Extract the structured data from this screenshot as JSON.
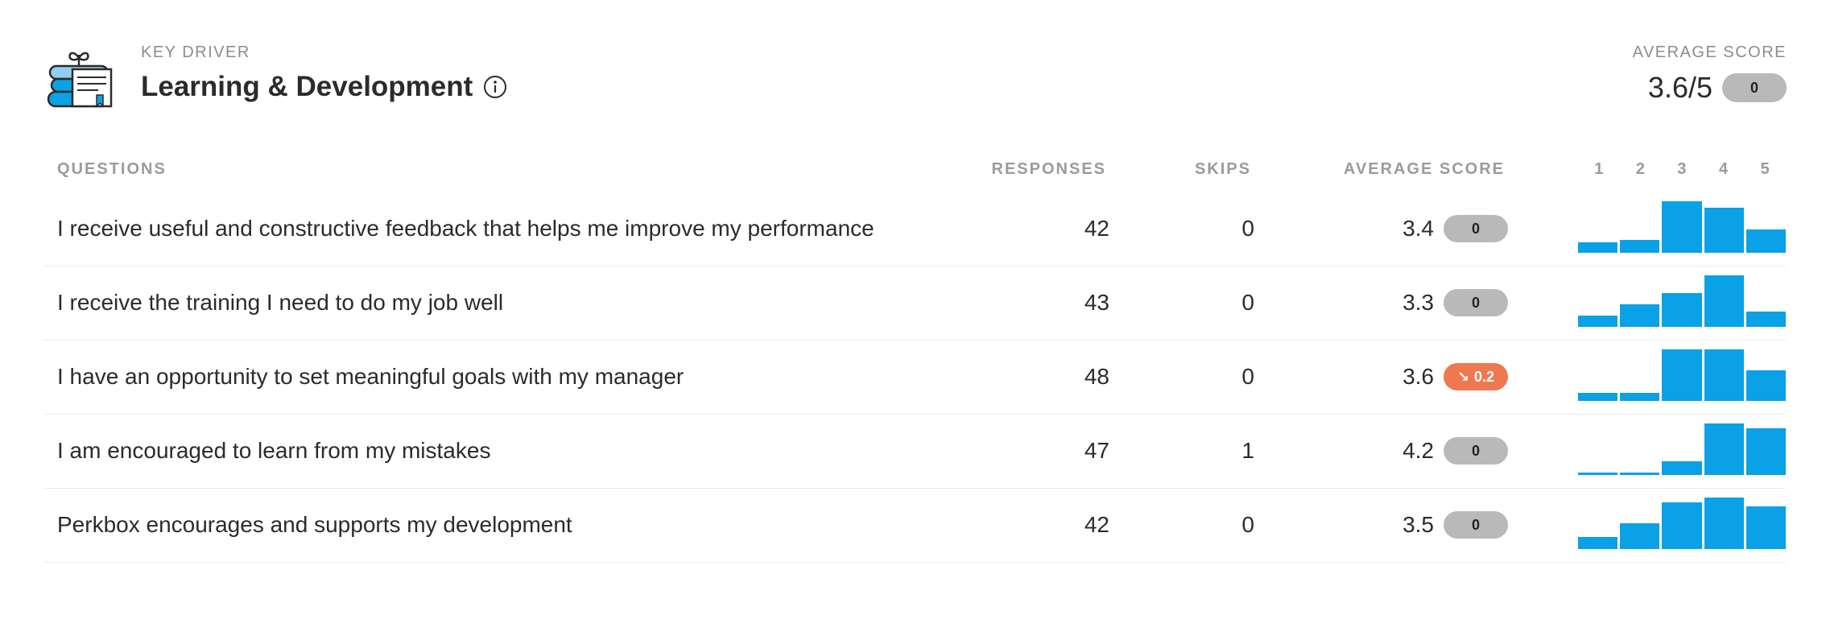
{
  "header": {
    "eyebrow": "KEY DRIVER",
    "title": "Learning & Development",
    "icon": "books-plant-icon",
    "info_icon": "info-icon",
    "average": {
      "label": "AVERAGE SCORE",
      "value": "3.6/5",
      "change": "0"
    }
  },
  "table": {
    "columns": {
      "questions": "QUESTIONS",
      "responses": "RESPONSES",
      "skips": "SKIPS",
      "average_score": "AVERAGE SCORE"
    },
    "scale": [
      "1",
      "2",
      "3",
      "4",
      "5"
    ],
    "rows": [
      {
        "question": "I receive useful and constructive feedback that helps me improve my performance",
        "responses": "42",
        "skips": "0",
        "score": "3.4",
        "change": "0",
        "trend": "none",
        "distribution": [
          0.2,
          0.25,
          1.0,
          0.88,
          0.45
        ]
      },
      {
        "question": "I receive the training I need to do my job well",
        "responses": "43",
        "skips": "0",
        "score": "3.3",
        "change": "0",
        "trend": "none",
        "distribution": [
          0.22,
          0.43,
          0.66,
          1.0,
          0.3
        ]
      },
      {
        "question": "I have an opportunity to set meaningful goals with my manager",
        "responses": "48",
        "skips": "0",
        "score": "3.6",
        "change": "0.2",
        "trend": "down",
        "distribution": [
          0.15,
          0.15,
          1.0,
          1.0,
          0.6
        ]
      },
      {
        "question": "I am encouraged to learn from my mistakes",
        "responses": "47",
        "skips": "1",
        "score": "4.2",
        "change": "0",
        "trend": "none",
        "distribution": [
          0.04,
          0.04,
          0.26,
          1.0,
          0.91
        ]
      },
      {
        "question": "Perkbox encourages and supports my development",
        "responses": "42",
        "skips": "0",
        "score": "3.5",
        "change": "0",
        "trend": "none",
        "distribution": [
          0.24,
          0.5,
          0.9,
          1.0,
          0.83
        ]
      }
    ]
  },
  "colors": {
    "bar": "#0aa1e6",
    "badge_neutral": "#b9b9b9",
    "badge_down": "#ef7850"
  }
}
